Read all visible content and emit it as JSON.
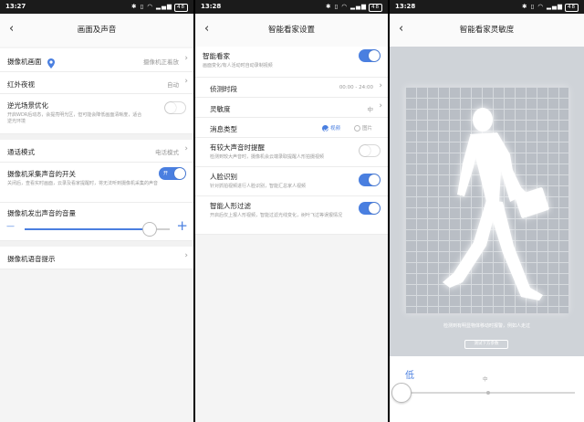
{
  "status": {
    "p1_time": "13:27",
    "p2_time": "13:28",
    "p3_time": "13:28",
    "icons": "✱ ▯ ◠ ▂▄▆",
    "battery": "48"
  },
  "screen1": {
    "title": "画面及声音",
    "camera_picture": {
      "label": "摄像机画面",
      "value": "摄像机正着放"
    },
    "night_vision": {
      "label": "红外夜视",
      "value": "自动"
    },
    "backlight": {
      "label": "逆光场景优化",
      "desc": "开启WDR后动态，会提亮明光区，但可能会降低画面清晰度，适合逆光环境"
    },
    "call_mode": {
      "label": "通话模式",
      "value": "电话模式"
    },
    "mic_switch": {
      "label": "摄像机采集声音的开关",
      "toggle_text": "开",
      "desc": "关闭后，查看实时画面，云录及看家提醒时，将无法听到摄像机采集的声音"
    },
    "volume": {
      "label": "摄像机发出声音的音量",
      "minus": "—",
      "plus": "+",
      "level": 0.86
    },
    "voice_prompt": {
      "label": "摄像机语音提示"
    }
  },
  "screen2": {
    "title": "智能看家设置",
    "smart_guard": {
      "label": "智能看家",
      "desc": "画面变化/有人活动时自动录制视频"
    },
    "detect_period": {
      "label": "侦测时段",
      "value": "00:00 - 24:00"
    },
    "sensitivity": {
      "label": "灵敏度",
      "value": "中"
    },
    "msg_type": {
      "label": "消息类型",
      "opt_video": "视频",
      "opt_image": "图片"
    },
    "loud_sound": {
      "label": "有较大声音时提醒",
      "desc": "检测到较大声音时，摄像机会云端录取提醒人形拍摄视频"
    },
    "face_rec": {
      "label": "人脸识别",
      "desc": "针对抓拍视频进行人脸识别，智能汇总家人视频"
    },
    "human_filter": {
      "label": "智能人形过滤",
      "desc": "开启后仅上报人形视频，智能过滤光线变化，树叶飞过等误报情况"
    }
  },
  "screen3": {
    "title": "智能看家灵敏度",
    "hint": "检测到有明显物体移动时报警，例如人走过",
    "hint_btn": "测试下方参数",
    "low": "低",
    "mid": "中",
    "level": 0
  },
  "colors": {
    "accent": "#4a7fe0"
  }
}
